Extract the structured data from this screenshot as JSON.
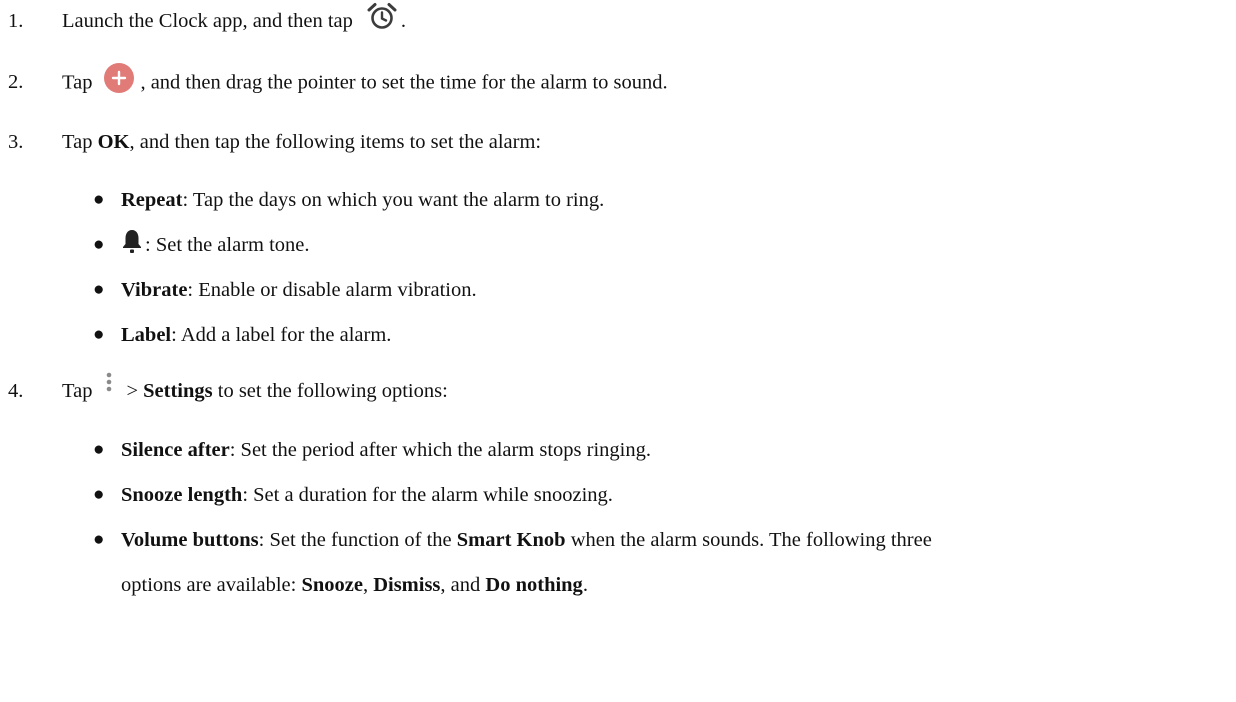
{
  "steps": [
    {
      "num": "1.",
      "text_a": "Launch the Clock app, and then tap",
      "text_b": "."
    },
    {
      "num": "2.",
      "text_a": "Tap",
      "text_b": ", and then drag the pointer to set the time for the alarm to sound."
    },
    {
      "num": "3.",
      "text_a": "Tap ",
      "bold_a": "OK",
      "text_b": ", and then tap the following items to set the alarm:"
    },
    {
      "num": "4.",
      "text_a": "Tap",
      "bold_a": "Settings",
      "text_b": " to set the following options:",
      "sep": "> "
    }
  ],
  "bullet_char": "●",
  "alarm_items": [
    {
      "bold": "Repeat",
      "text": ": Tap the days on which you want the alarm to ring."
    },
    {
      "text": ": Set the alarm tone."
    },
    {
      "bold": "Vibrate",
      "text": ": Enable or disable alarm vibration."
    },
    {
      "bold": "Label",
      "text": ": Add a label for the alarm."
    }
  ],
  "settings_items": [
    {
      "bold": "Silence after",
      "text": ": Set the period after which the alarm stops ringing."
    },
    {
      "bold": "Snooze length",
      "text": ": Set a duration for the alarm while snoozing."
    },
    {
      "bold": "Volume buttons",
      "text": ": Set the function of the ",
      "bold2": "Smart Knob",
      "text2": " when the alarm sounds. The following three"
    }
  ],
  "continuation": {
    "text_a": "options are available: ",
    "bold_a": "Snooze",
    "text_b": ", ",
    "bold_b": "Dismiss",
    "text_c": ", and ",
    "bold_c": "Do nothing",
    "text_d": "."
  },
  "icons": {
    "alarm": "alarm-clock-icon",
    "add": "add-alarm-icon",
    "bell": "bell-icon",
    "more": "more-vertical-icon"
  },
  "colors": {
    "text": "#111111",
    "icon_dark": "#3c3c3c",
    "add_button": "#e07b78"
  }
}
